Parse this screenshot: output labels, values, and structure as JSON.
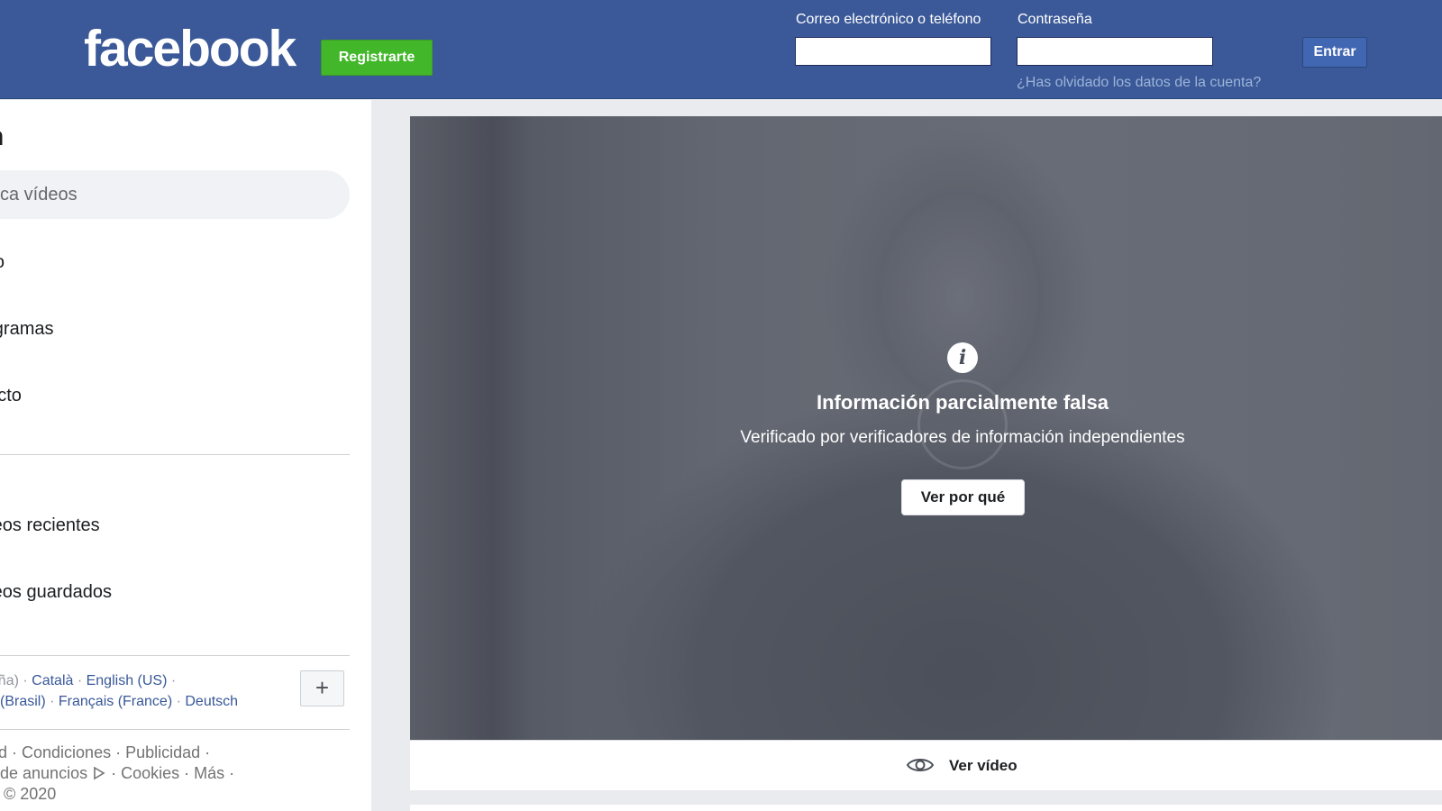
{
  "header": {
    "logo": "facebook",
    "register_label": "Registrarte",
    "email_label": "Correo electrónico o teléfono",
    "password_label": "Contraseña",
    "email_value": "",
    "password_value": "",
    "login_label": "Entrar",
    "forgot_link": "¿Has olvidado los datos de la cuenta?",
    "bg_color": "#3b5998"
  },
  "sidebar": {
    "title": "h",
    "search_placeholder": "ca vídeos",
    "nav_items": [
      "icio",
      "rogramas",
      "irecto"
    ],
    "saved_items": [
      "ídeos recientes",
      "ídeos guardados"
    ],
    "languages_line1": [
      "spaña)",
      "Català",
      "English (US)"
    ],
    "languages_line2": [
      "(Brasil)",
      "Français (France)",
      "Deutsch"
    ],
    "plus_label": "+",
    "footer_line1": [
      "d",
      "Condiciones",
      "Publicidad"
    ],
    "footer_line2": [
      "de anuncios",
      "Cookies",
      "Más"
    ],
    "footer_line3": "© 2020"
  },
  "video": {
    "warning_title": "Información parcialmente falsa",
    "warning_subtitle": "Verificado por verificadores de información independientes",
    "why_button": "Ver por qué",
    "watch_label": "Ver vídeo"
  }
}
